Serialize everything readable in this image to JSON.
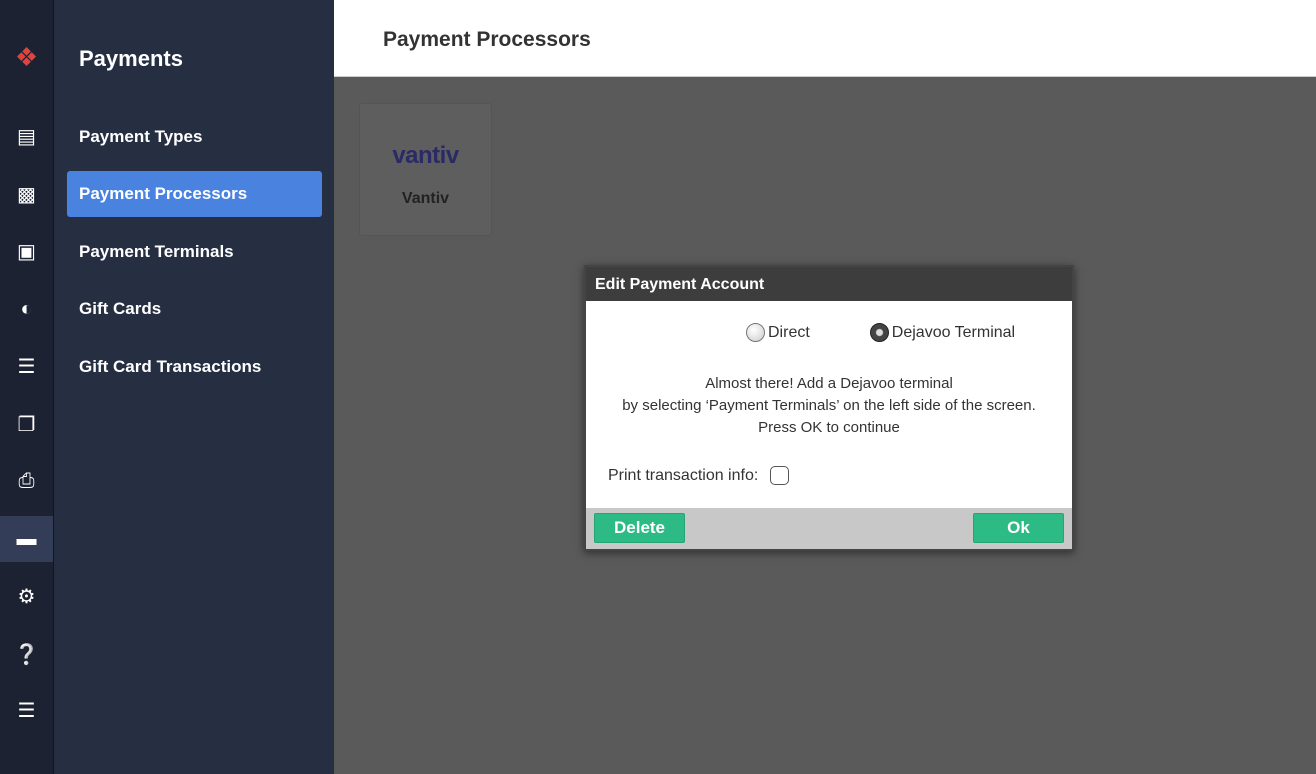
{
  "rail": {
    "icons": [
      "lightspeed-logo-icon",
      "reports-icon",
      "clipboard-icon",
      "customer-card-icon",
      "dining-icon",
      "layers-icon",
      "devices-icon",
      "printer-icon",
      "payments-icon",
      "gear-icon",
      "help-icon",
      "server-icon"
    ],
    "active": "payments-icon",
    "logo_color": "#e0433c"
  },
  "sidebar": {
    "title": "Payments",
    "items": [
      {
        "label": "Payment Types"
      },
      {
        "label": "Payment Processors",
        "active": true
      },
      {
        "label": "Payment Terminals"
      },
      {
        "label": "Gift Cards"
      },
      {
        "label": "Gift Card Transactions"
      }
    ]
  },
  "header": {
    "title": "Payment Processors"
  },
  "processors": [
    {
      "logo": "vantiv",
      "name": "Vantiv"
    }
  ],
  "dialog": {
    "title": "Edit Payment Account",
    "options": [
      {
        "label": "Direct",
        "selected": false
      },
      {
        "label": "Dejavoo Terminal",
        "selected": true
      }
    ],
    "message": [
      "Almost there! Add a Dejavoo terminal",
      "by selecting ‘Payment Terminals’ on the left side of the screen.",
      "Press OK to continue"
    ],
    "print_label": "Print transaction info:",
    "print_checked": false,
    "delete_label": "Delete",
    "ok_label": "Ok"
  },
  "colors": {
    "accent": "#4a82e0",
    "button": "#2dbb85"
  }
}
